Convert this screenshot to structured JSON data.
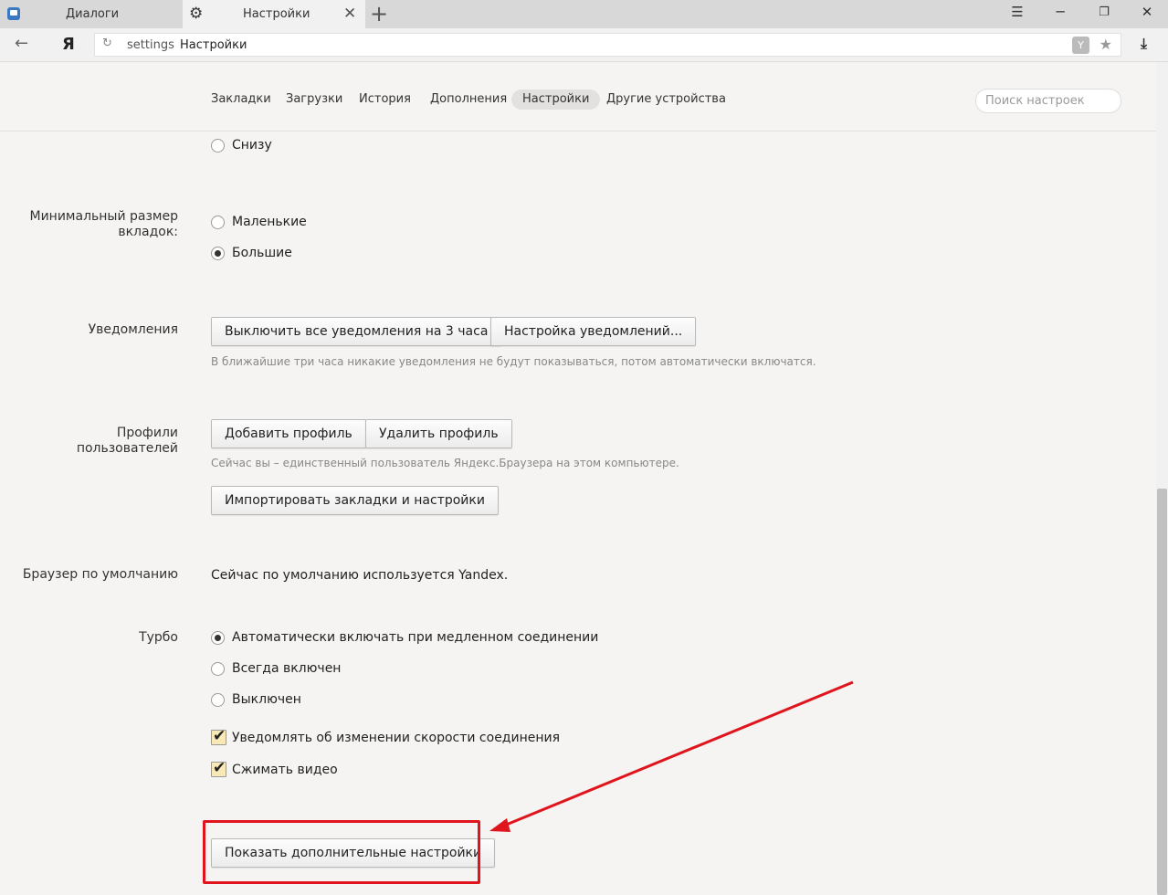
{
  "tabs": [
    {
      "label": "Диалоги"
    },
    {
      "label": "Настройки"
    }
  ],
  "address": {
    "host": "settings",
    "path": "Настройки"
  },
  "nav": {
    "items": [
      "Закладки",
      "Загрузки",
      "История",
      "Дополнения",
      "Настройки",
      "Другие устройства"
    ],
    "active": "Настройки",
    "search_placeholder": "Поиск настроек"
  },
  "tabs_position": {
    "option_bottom": "Снизу"
  },
  "min_tab_size": {
    "label": "Минимальный размер вкладок:",
    "options": [
      "Маленькие",
      "Большие"
    ],
    "selected": "Большие"
  },
  "notifications": {
    "label": "Уведомления",
    "mute_button": "Выключить все уведомления на 3 часа",
    "settings_button": "Настройка уведомлений...",
    "hint": "В ближайшие три часа никакие уведомления не будут показываться, потом автоматически включатся."
  },
  "profiles": {
    "label": "Профили пользователей",
    "add_button": "Добавить профиль",
    "delete_button": "Удалить профиль",
    "hint": "Сейчас вы – единственный пользователь Яндекс.Браузера на этом компьютере.",
    "import_button": "Импортировать закладки и настройки"
  },
  "default_browser": {
    "label": "Браузер по умолчанию",
    "text": "Сейчас по умолчанию используется Yandex."
  },
  "turbo": {
    "label": "Турбо",
    "options": [
      "Автоматически включать при медленном соединении",
      "Всегда включен",
      "Выключен"
    ],
    "selected": "Автоматически включать при медленном соединении",
    "checkboxes": [
      {
        "label": "Уведомлять об изменении скорости соединения",
        "checked": true
      },
      {
        "label": "Сжимать видео",
        "checked": true
      }
    ]
  },
  "advanced_button": "Показать дополнительные настройки",
  "colors": {
    "annotation": "#e0141c",
    "checkbox_fill": "#f8e9b6"
  }
}
